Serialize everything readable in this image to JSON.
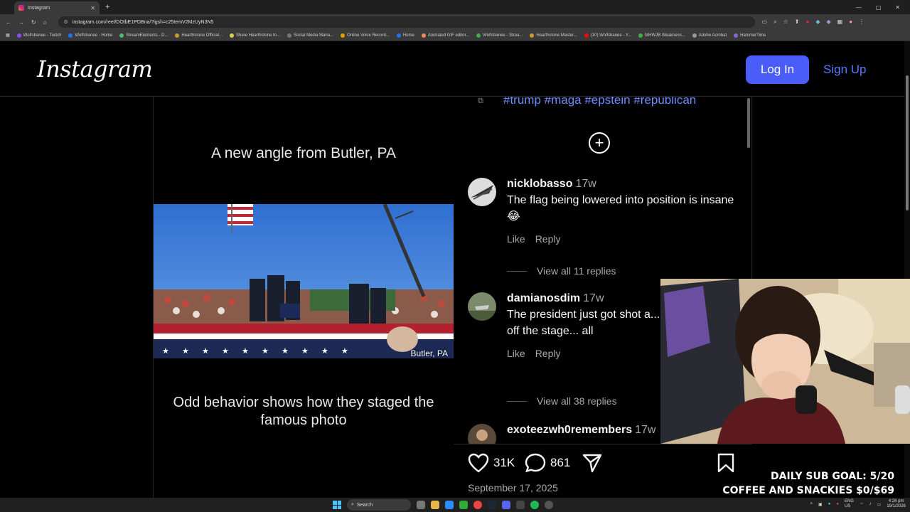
{
  "browser": {
    "tab_title": "Instagram",
    "url": "instagram.com/reel/DOtbE1PDBna/?igsh=c25temV2MzUyN3N5",
    "bookmarks": [
      "Wolfsbanee - Twitch",
      "Wolfsbanee - Home",
      "StreamElements - D...",
      "Hearthstone Official...",
      "Share Hearthstone to...",
      "Social Media Mana...",
      "Online Voice Record...",
      "Home",
      "Animated GIF editor...",
      "Wolfsbanee - Strea...",
      "Hearthstone Master...",
      "(10) Wolfsbanee - Y...",
      "MHWJB Weakness...",
      "Adobe Acrobat",
      "HammerTime"
    ]
  },
  "header": {
    "logo": "Instagram",
    "login_label": "Log In",
    "signup_label": "Sign Up"
  },
  "video": {
    "title": "A new angle from Butler, PA",
    "caption": "Odd behavior shows how they staged the famous photo",
    "overlay_location": "Butler, PA"
  },
  "post": {
    "hashtags": "#trump #maga #epstein #republican",
    "comments": [
      {
        "user": "nicklobasso",
        "time": "17w",
        "text": "The flag being lowered into position is insane 😂",
        "like_label": "Like",
        "reply_label": "Reply",
        "view_replies": "View all 11 replies"
      },
      {
        "user": "damianosdim",
        "time": "17w",
        "text": "The president just got shot a... didn't pull him off the stage... all",
        "like_label": "Like",
        "reply_label": "Reply",
        "view_replies": "View all 38 replies"
      },
      {
        "user": "exoteezwh0remembers",
        "time": "17w"
      }
    ],
    "likes": "31K",
    "comment_count": "861",
    "date": "September 17, 2025"
  },
  "stream": {
    "sub_goal": "DAILY SUB GOAL: 5/20",
    "tip_goal": "COFFEE AND SNACKIES $0/$69"
  },
  "taskbar": {
    "search_label": "Search",
    "lang": "ENG\nUS",
    "time": "4:28 pm",
    "date": "19/1/2026"
  },
  "colors": {
    "accent_button": "#4a5df9",
    "link": "#5b7bff",
    "hashtag": "#6f8cff",
    "muted_text": "#a8a8a8"
  }
}
